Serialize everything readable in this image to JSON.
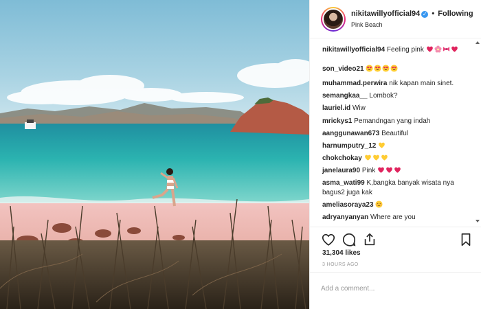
{
  "post": {
    "photo_alt": "",
    "header": {
      "username": "nikitawillyofficial94",
      "verified": true,
      "separator": "•",
      "follow_label": "Following",
      "location": "Pink Beach"
    },
    "comments": [
      {
        "user": "nikitawillyofficial94",
        "text": "Feeling pink",
        "emojis": [
          "red-heart",
          "pink-flower",
          "pink-bow",
          "red-heart"
        ]
      },
      {
        "user": "son_video21",
        "text": "",
        "emojis": [
          "heart-eyes",
          "heart-eyes",
          "heart-eyes",
          "heart-eyes"
        ]
      },
      {
        "user": "muhammad.perwira",
        "text": "nik kapan main sinet.",
        "emojis": []
      },
      {
        "user": "semangkaa__",
        "text": "Lombok?",
        "emojis": []
      },
      {
        "user": "lauriel.id",
        "text": "Wiw",
        "emojis": []
      },
      {
        "user": "mrickys1",
        "text": "Pemandngan yang indah",
        "emojis": []
      },
      {
        "user": "aanggunawan673",
        "text": "Beautiful",
        "emojis": []
      },
      {
        "user": "harnumputry_12",
        "text": "",
        "emojis": [
          "yellow-heart"
        ]
      },
      {
        "user": "chokchokay",
        "text": "",
        "emojis": [
          "yellow-heart",
          "yellow-heart",
          "yellow-heart"
        ]
      },
      {
        "user": "janelaura90",
        "text": "Pink",
        "emojis": [
          "red-heart",
          "red-heart",
          "red-heart"
        ]
      },
      {
        "user": "asma_wati99",
        "text": "K,bangka banyak wisata nya bagus2 juga kak",
        "emojis": []
      },
      {
        "user": "ameliasoraya23",
        "text": "",
        "emojis": [
          "smiling-blush"
        ]
      },
      {
        "user": "adryanyanyan",
        "text": "Where are you",
        "emojis": []
      }
    ],
    "likes": "31,304 likes",
    "time_ago": "3 HOURS AGO",
    "add_comment_placeholder": "Add a comment..."
  },
  "colors": {
    "verified_blue": "#3897f0",
    "text": "#262626",
    "muted": "#999999",
    "border": "#efefef",
    "red_heart": "#e0245e",
    "yellow_heart": "#ffcc33"
  }
}
